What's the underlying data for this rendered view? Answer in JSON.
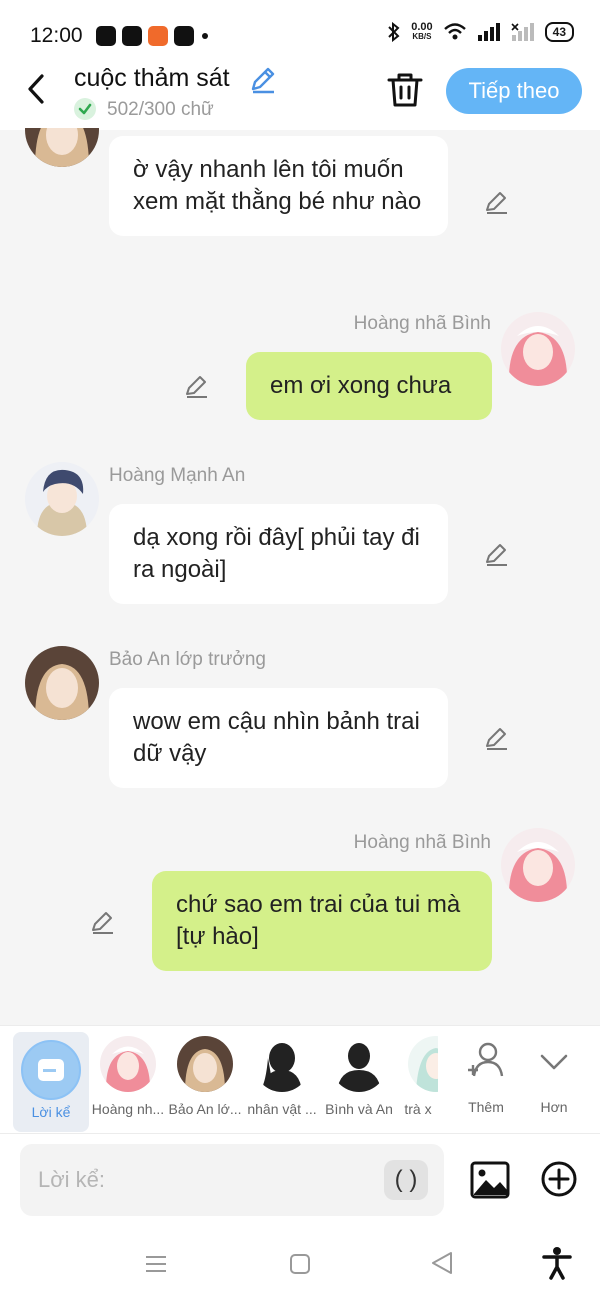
{
  "status_bar": {
    "time": "12:00",
    "net_speed": "0.00",
    "net_unit": "KB/S",
    "battery": "43"
  },
  "header": {
    "title": "cuộc thảm sát",
    "counter": "502/300 chữ",
    "next_label": "Tiếp theo"
  },
  "messages": [
    {
      "side": "left",
      "name": "",
      "text": "ờ vậy nhanh lên tôi muốn xem mặt thằng bé như nào"
    },
    {
      "side": "right",
      "name": "Hoàng nhã Bình",
      "text": "em ơi xong chưa"
    },
    {
      "side": "left",
      "name": "Hoàng Mạnh An",
      "text": "dạ xong rồi đây[ phủi tay đi ra ngoài]"
    },
    {
      "side": "left",
      "name": "Bảo An lớp trưởng",
      "text": "wow em cậu nhìn bảnh trai dữ vậy"
    },
    {
      "side": "right",
      "name": "Hoàng nhã Bình",
      "text": "chứ sao em trai của tui mà [tự hào]"
    }
  ],
  "characters": [
    {
      "label": "Lời kể",
      "selected": true
    },
    {
      "label": "Hoàng nh..."
    },
    {
      "label": "Bảo An lớ..."
    },
    {
      "label": "nhân vật ..."
    },
    {
      "label": "Bình và An"
    },
    {
      "label": "trà x"
    }
  ],
  "actions": {
    "add_label": "Thêm",
    "more_label": "Hơn"
  },
  "input": {
    "placeholder": "Lời kể:",
    "paren_label": "( )"
  },
  "colors": {
    "accent": "#64b5f6",
    "bubble_right": "#d4f08a",
    "bubble_left": "#ffffff"
  }
}
